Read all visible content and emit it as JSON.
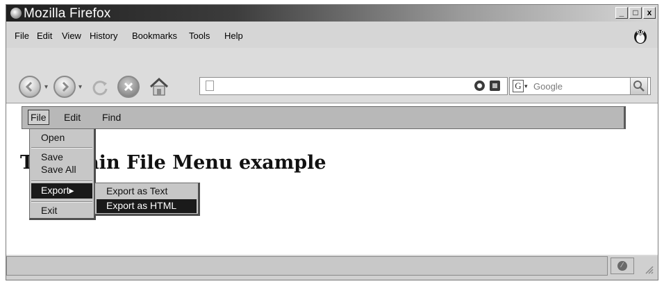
{
  "window": {
    "title": "Mozilla Firefox",
    "controls": {
      "minimize": "_",
      "maximize": "□",
      "close": "x"
    }
  },
  "menubar": {
    "items": [
      "File",
      "Edit",
      "View",
      "History",
      "Bookmarks",
      "Tools",
      "Help"
    ]
  },
  "toolbar": {
    "url": "",
    "search_placeholder": "Google",
    "search_engine_letter": "G"
  },
  "page": {
    "menubar": [
      "File",
      "Edit",
      "Find"
    ],
    "heading": "The Main File Menu example",
    "file_menu": [
      "Open",
      "Save",
      "Save All",
      "Export",
      "Exit"
    ],
    "export_arrow": "▸",
    "export_submenu": [
      "Export as Text",
      "Export as HTML"
    ]
  },
  "colors": {
    "highlight": "#1a1a1a",
    "menu_bg": "#c7c7c7",
    "toolbar_bg": "#dcdcdc"
  },
  "icons": [
    "firefox-icon",
    "back-icon",
    "forward-icon",
    "reload-icon",
    "stop-icon",
    "home-icon",
    "page-icon",
    "go-icon",
    "rss-icon",
    "search-icon",
    "throbber-icon",
    "block-icon",
    "resize-grip-icon"
  ]
}
